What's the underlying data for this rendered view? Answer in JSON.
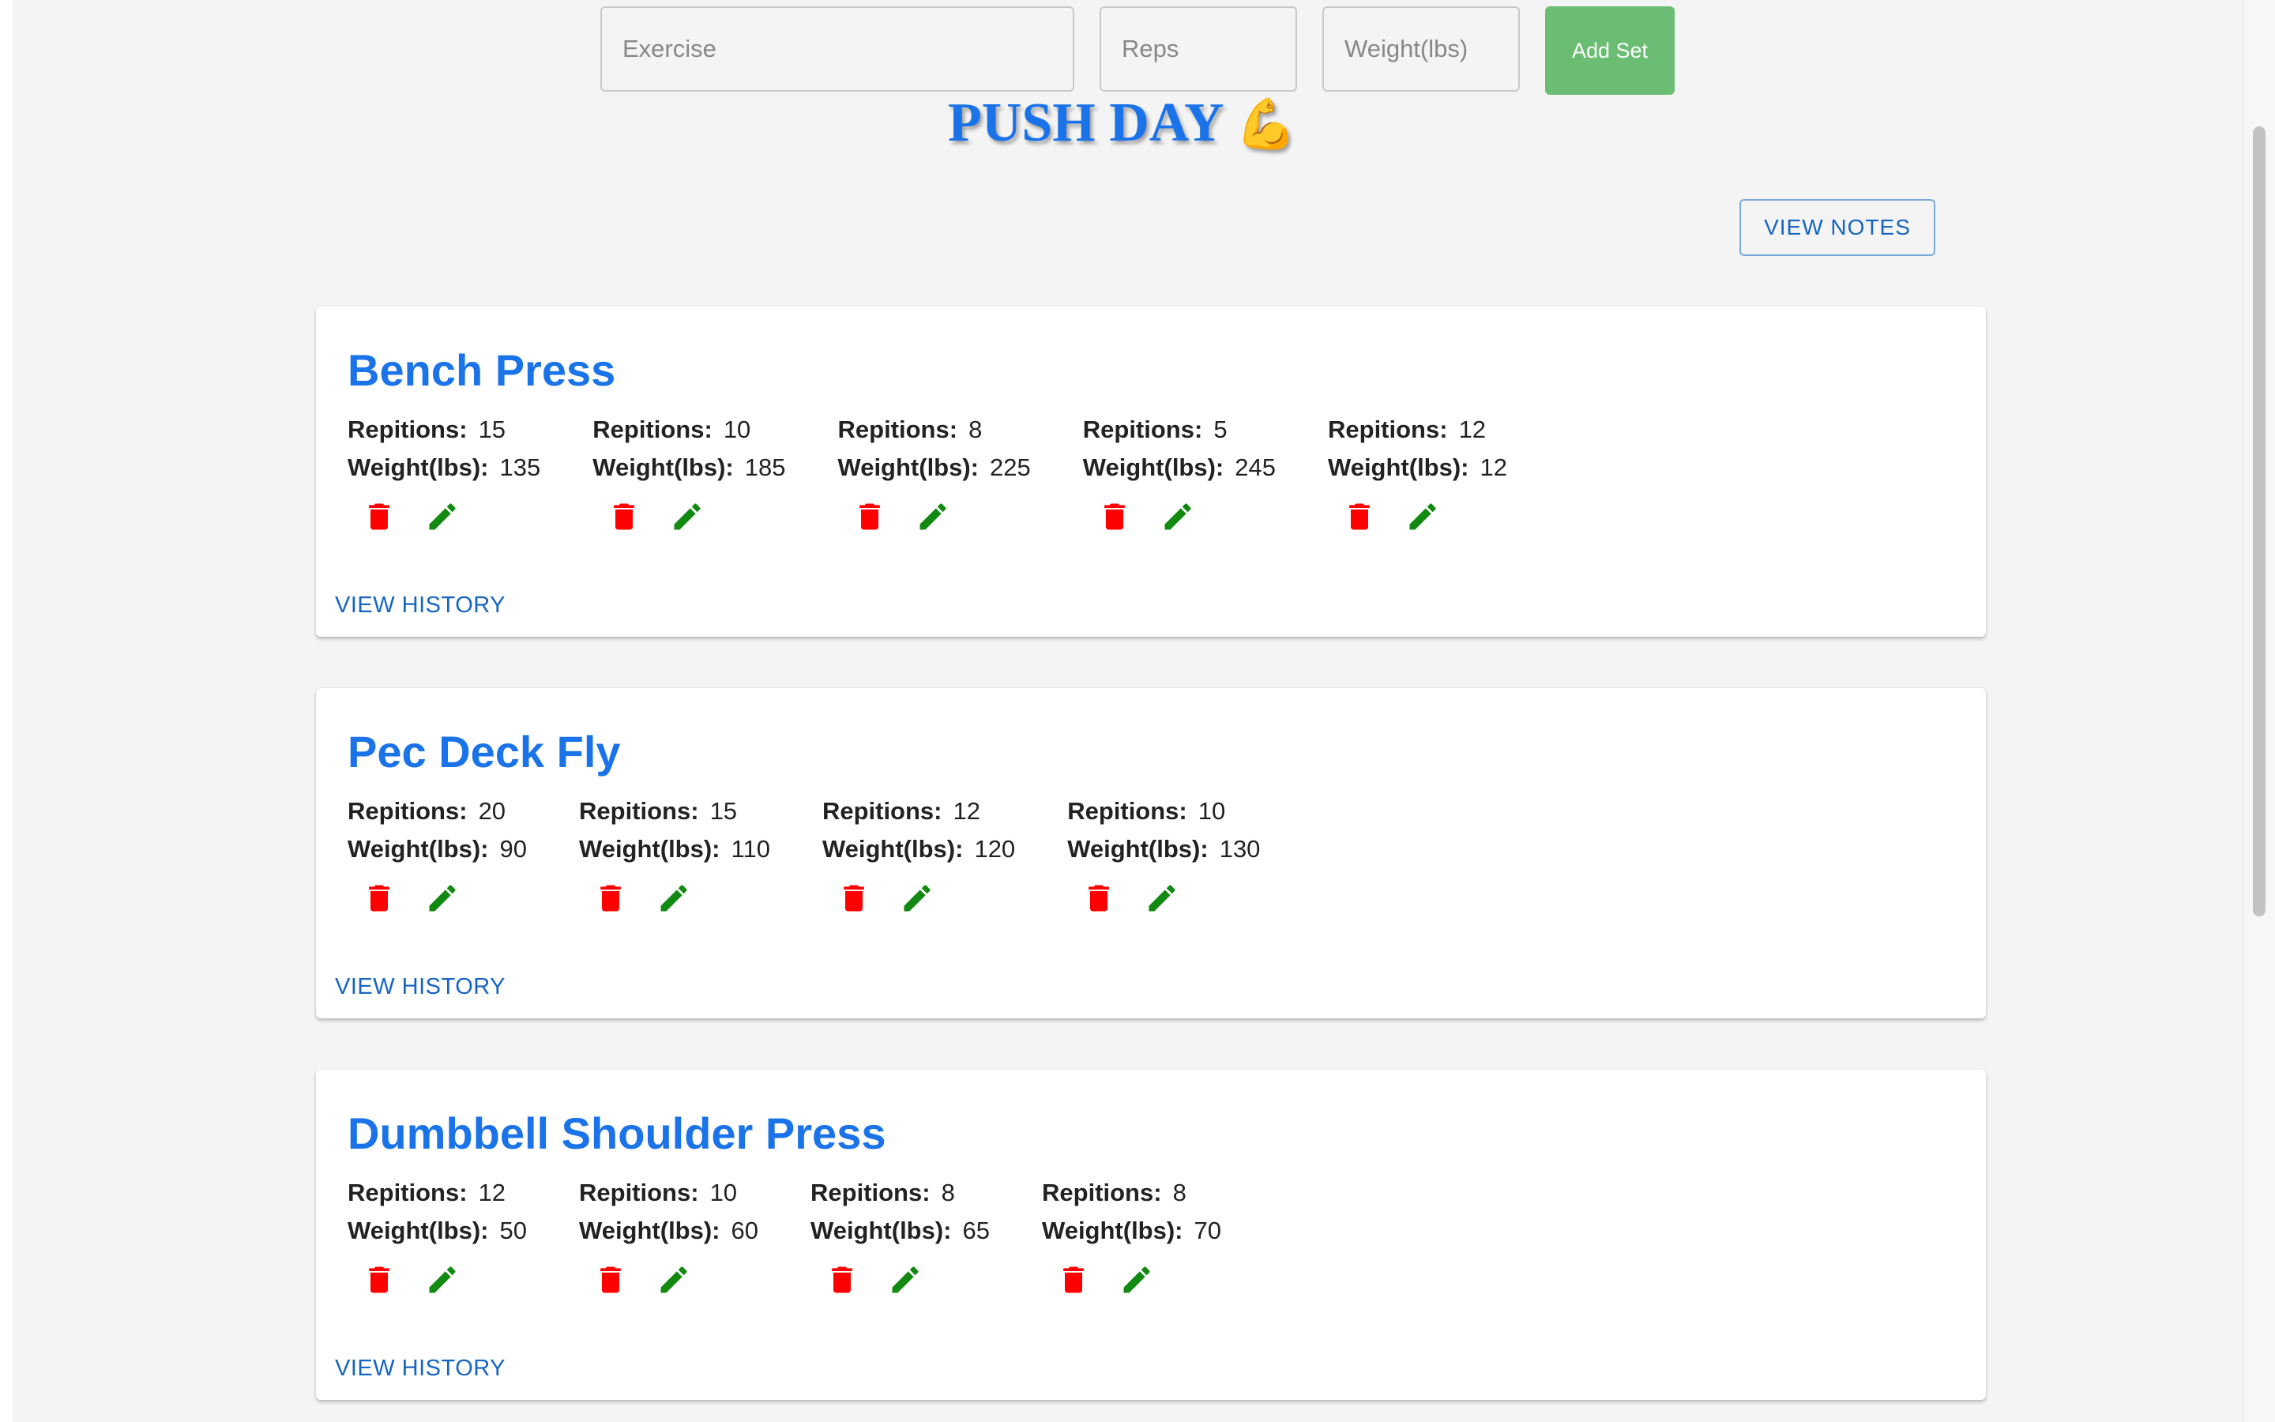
{
  "form": {
    "exercise_placeholder": "Exercise",
    "reps_placeholder": "Reps",
    "weight_placeholder": "Weight(lbs)",
    "add_label": "Add Set"
  },
  "page_title": "PUSH DAY",
  "page_title_emoji": "💪",
  "view_notes_label": "VIEW NOTES",
  "labels": {
    "reps": "Repitions:",
    "weight": "Weight(lbs):",
    "history": "VIEW HISTORY"
  },
  "icons": {
    "delete": "trash-icon",
    "edit": "pencil-icon"
  },
  "colors": {
    "accent": "#1a73e8",
    "add_button": "#6cbd74",
    "delete": "#ff0000",
    "edit": "#128a12",
    "background": "#f4f4f4"
  },
  "exercises": [
    {
      "name": "Bench Press",
      "sets": [
        {
          "reps": "15",
          "weight": "135"
        },
        {
          "reps": "10",
          "weight": "185"
        },
        {
          "reps": "8",
          "weight": "225"
        },
        {
          "reps": "5",
          "weight": "245"
        },
        {
          "reps": "12",
          "weight": "12"
        }
      ]
    },
    {
      "name": "Pec Deck Fly",
      "sets": [
        {
          "reps": "20",
          "weight": "90"
        },
        {
          "reps": "15",
          "weight": "110"
        },
        {
          "reps": "12",
          "weight": "120"
        },
        {
          "reps": "10",
          "weight": "130"
        }
      ]
    },
    {
      "name": "Dumbbell Shoulder Press",
      "sets": [
        {
          "reps": "12",
          "weight": "50"
        },
        {
          "reps": "10",
          "weight": "60"
        },
        {
          "reps": "8",
          "weight": "65"
        },
        {
          "reps": "8",
          "weight": "70"
        }
      ]
    }
  ]
}
